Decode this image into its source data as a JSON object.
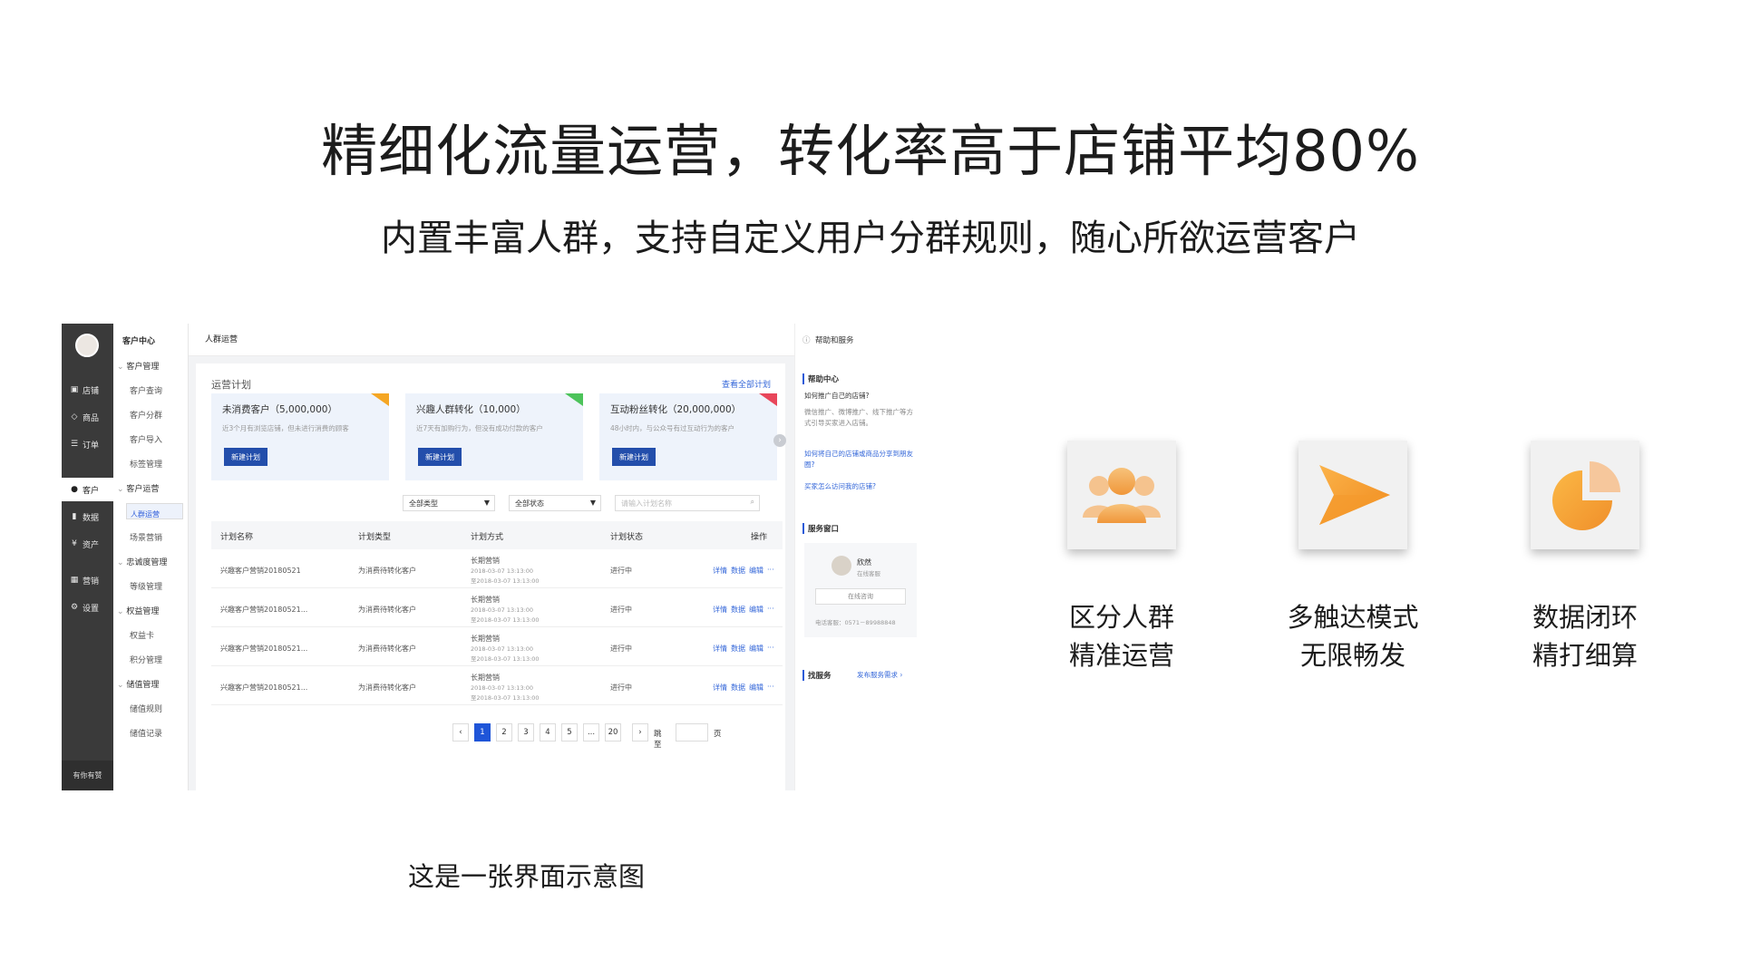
{
  "headline": "精细化流量运营，转化率高于店铺平均80%",
  "subheadline": "内置丰富人群，支持自定义用户分群规则，随心所欲运营客户",
  "caption": "这是一张界面示意图",
  "app": {
    "left_nav": {
      "items": [
        {
          "icon": "store-icon",
          "label": "店铺"
        },
        {
          "icon": "tag-icon",
          "label": "商品"
        },
        {
          "icon": "list-icon",
          "label": "订单"
        },
        {
          "icon": "user-icon",
          "label": "客户"
        },
        {
          "icon": "bar-chart-icon",
          "label": "数据"
        },
        {
          "icon": "yen-icon",
          "label": "资产"
        },
        {
          "icon": "grid-icon",
          "label": "营销"
        },
        {
          "icon": "gear-icon",
          "label": "设置"
        }
      ],
      "footer": "有你有赞"
    },
    "sub_nav": {
      "title": "客户中心",
      "groups": [
        {
          "label": "客户管理",
          "items": [
            "客户查询",
            "客户分群",
            "客户导入",
            "标签管理"
          ]
        },
        {
          "label": "客户运营",
          "items": [
            "人群运营",
            "场景营销"
          ]
        },
        {
          "label": "忠诚度管理",
          "items": [
            "等级管理"
          ]
        },
        {
          "label": "权益管理",
          "items": [
            "权益卡",
            "积分管理"
          ]
        },
        {
          "label": "储值管理",
          "items": [
            "储值规则",
            "储值记录"
          ]
        }
      ],
      "selected": "人群运营"
    },
    "page_title": "人群运营",
    "section_title": "运营计划",
    "view_all": "查看全部计划",
    "plans": [
      {
        "title": "未消费客户（5,000,000）",
        "desc": "近3个月有浏览店铺，但未进行消费的顾客",
        "button": "新建计划",
        "tag_color": "#f5a623"
      },
      {
        "title": "兴趣人群转化（10,000）",
        "desc": "近7天有加购行为，但没有成功付款的客户",
        "button": "新建计划",
        "tag_color": "#4cc35a"
      },
      {
        "title": "互动粉丝转化（20,000,000）",
        "desc": "48小时内，与公众号有过互动行为的客户",
        "button": "新建计划",
        "tag_color": "#e8465a"
      }
    ],
    "filters": {
      "type": "全部类型",
      "status": "全部状态",
      "search_placeholder": "请输入计划名称"
    },
    "table": {
      "headers": [
        "计划名称",
        "计划类型",
        "计划方式",
        "计划状态",
        "操作"
      ],
      "rows": [
        {
          "name": "兴趣客户营销20180521",
          "type": "为消费待转化客户",
          "mode": "长期营销",
          "start": "2018-03-07 13:13:00",
          "end": "至2018-03-07 13:13:00",
          "status": "进行中"
        },
        {
          "name": "兴趣客户营销20180521...",
          "type": "为消费待转化客户",
          "mode": "长期营销",
          "start": "2018-03-07 13:13:00",
          "end": "至2018-03-07 13:13:00",
          "status": "进行中"
        },
        {
          "name": "兴趣客户营销20180521...",
          "type": "为消费待转化客户",
          "mode": "长期营销",
          "start": "2018-03-07 13:13:00",
          "end": "至2018-03-07 13:13:00",
          "status": "进行中"
        },
        {
          "name": "兴趣客户营销20180521...",
          "type": "为消费待转化客户",
          "mode": "长期营销",
          "start": "2018-03-07 13:13:00",
          "end": "至2018-03-07 13:13:00",
          "status": "进行中"
        }
      ],
      "actions": [
        "详情",
        "数据",
        "编辑",
        "···"
      ]
    },
    "pagination": {
      "pages": [
        "1",
        "2",
        "3",
        "4",
        "5",
        "...",
        "20"
      ],
      "current": "1",
      "jump_label": "跳至",
      "page_unit": "页"
    },
    "help": {
      "title": "帮助和服务",
      "center_title": "帮助中心",
      "q1": "如何推广自己的店铺?",
      "q1_text": "微信推广、微博推广、线下推广等方式引导买家进入店铺。",
      "link1": "如何将自己的店铺或商品分享到朋友圈?",
      "link2": "买家怎么访问我的店铺?",
      "service_title": "服务窗口",
      "agent_name": "欣然",
      "agent_status": "在线客服",
      "consult_button": "在线咨询",
      "phone": "电话客服：0571－89988848",
      "find_service": "找服务",
      "publish_demand": "发布服务需求 ›"
    }
  },
  "features": [
    {
      "icon": "users-group-icon",
      "line1": "区分人群",
      "line2": "精准运营"
    },
    {
      "icon": "paper-plane-icon",
      "line1": "多触达模式",
      "line2": "无限畅发"
    },
    {
      "icon": "pie-chart-icon",
      "line1": "数据闭环",
      "line2": "精打细算"
    }
  ]
}
